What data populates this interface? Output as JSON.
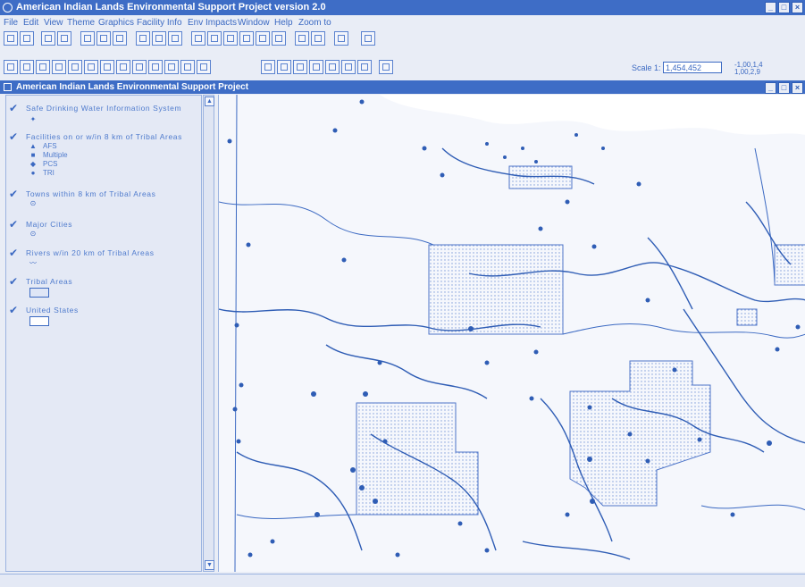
{
  "app": {
    "title": "American Indian Lands Environmental Support Project version 2.0",
    "window_buttons": [
      "_",
      "□",
      "×"
    ]
  },
  "menu": [
    "File",
    "Edit",
    "View",
    "Theme",
    "Graphics",
    "Facility Info",
    "Env Impacts",
    "Window",
    "Help",
    "Zoom to"
  ],
  "toolbar": {
    "scale_label": "Scale 1:",
    "scale_value": "1,454,452",
    "coords_1": "-1,00,1,4",
    "coords_2": "1,00,2,9"
  },
  "view": {
    "title": "American Indian Lands Environmental Support Project"
  },
  "toc": {
    "layers": [
      {
        "name": "Safe Drinking Water Information System",
        "legend": [
          {
            "symbol": "✦",
            "label": ""
          }
        ]
      },
      {
        "name": "Facilities on or w/in 8 km of Tribal Areas",
        "legend": [
          {
            "symbol": "▲",
            "label": "AFS"
          },
          {
            "symbol": "■",
            "label": "Multiple"
          },
          {
            "symbol": "◆",
            "label": "PCS"
          },
          {
            "symbol": "●",
            "label": "TRI"
          }
        ]
      },
      {
        "name": "Towns within 8 km of Tribal Areas",
        "legend": [
          {
            "symbol": "⊙",
            "label": ""
          }
        ]
      },
      {
        "name": "Major Cities",
        "legend": [
          {
            "symbol": "⊙",
            "label": ""
          }
        ]
      },
      {
        "name": "Rivers w/in 20 km of Tribal Areas",
        "legend": [
          {
            "symbol": "〰",
            "label": ""
          }
        ]
      },
      {
        "name": "Tribal Areas",
        "legend": []
      },
      {
        "name": "United States",
        "legend": []
      }
    ]
  },
  "colors": {
    "accent": "#3e6dc6",
    "map_line": "#2f5db5",
    "background": "#e9edf6"
  }
}
